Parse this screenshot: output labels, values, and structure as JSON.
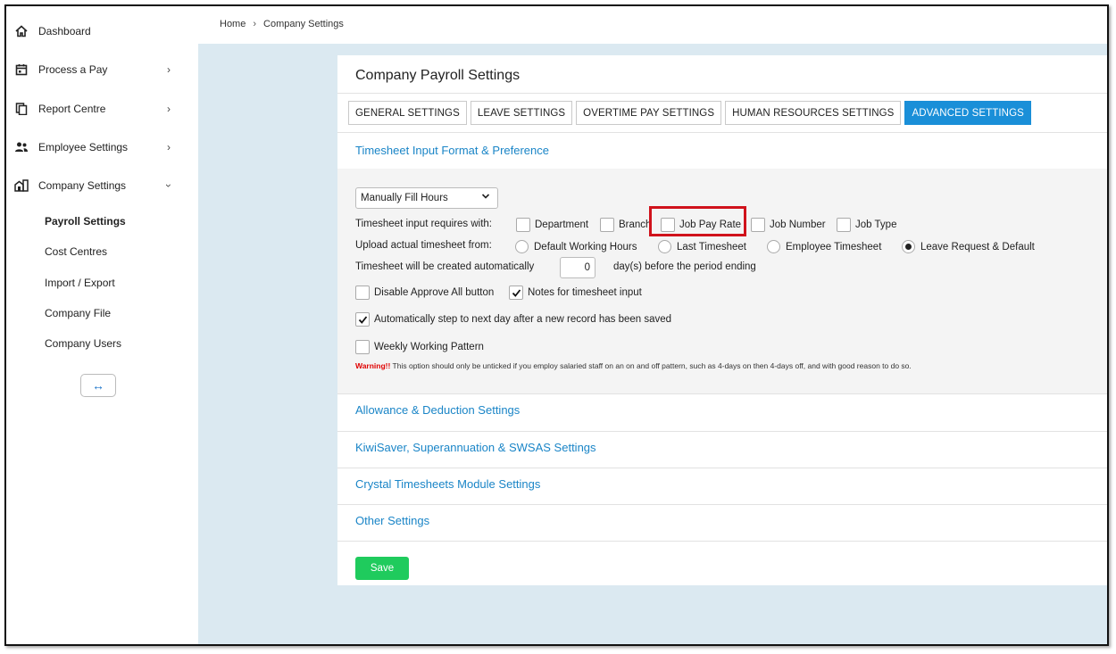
{
  "sidebar": {
    "items": [
      {
        "label": "Dashboard",
        "icon": "home-icon"
      },
      {
        "label": "Process a Pay",
        "icon": "calendar-icon"
      },
      {
        "label": "Report Centre",
        "icon": "copy-icon"
      },
      {
        "label": "Employee Settings",
        "icon": "people-icon"
      },
      {
        "label": "Company Settings",
        "icon": "building-icon"
      }
    ],
    "subitems": [
      "Payroll Settings",
      "Cost Centres",
      "Import / Export",
      "Company File",
      "Company Users"
    ],
    "collapse_icon": "↔"
  },
  "breadcrumb": {
    "home": "Home",
    "current": "Company Settings"
  },
  "card": {
    "title": "Company Payroll Settings",
    "tabs": [
      "GENERAL SETTINGS",
      "LEAVE SETTINGS",
      "OVERTIME PAY SETTINGS",
      "HUMAN RESOURCES SETTINGS",
      "ADVANCED SETTINGS"
    ],
    "active_tab": "ADVANCED SETTINGS",
    "section_open": "Timesheet Input Format & Preference",
    "format_select": "Manually Fill Hours",
    "requires_label": "Timesheet input requires with:",
    "requires_options": [
      "Department",
      "Branch",
      "Job Pay Rate",
      "Job Number",
      "Job Type"
    ],
    "upload_label": "Upload actual timesheet from:",
    "upload_options": [
      "Default Working Hours",
      "Last Timesheet",
      "Employee Timesheet",
      "Leave Request & Default"
    ],
    "upload_selected": "Leave Request & Default",
    "auto_label": "Timesheet will be created automatically",
    "auto_days": "0",
    "auto_suffix": "day(s) before the period ending",
    "disable_approve": "Disable Approve All button",
    "notes_input": "Notes for timesheet input",
    "auto_step": "Automatically step to next day after a new record has been saved",
    "weekly_pattern": "Weekly Working Pattern",
    "warning_prefix": "Warning!!",
    "warning_text": " This option should only be unticked if you employ salaried staff on an on and off pattern, such as 4-days on then 4-days off, and with good reason to do so.",
    "sections": [
      "Allowance & Deduction Settings",
      "KiwiSaver, Superannuation & SWSAS Settings",
      "Crystal Timesheets Module Settings",
      "Other Settings"
    ],
    "save_label": "Save"
  },
  "colors": {
    "accent": "#1a8fd8",
    "link": "#1a85c7",
    "save": "#1fcb5d",
    "highlight": "#d0121b",
    "background": "#dbe9f1"
  }
}
